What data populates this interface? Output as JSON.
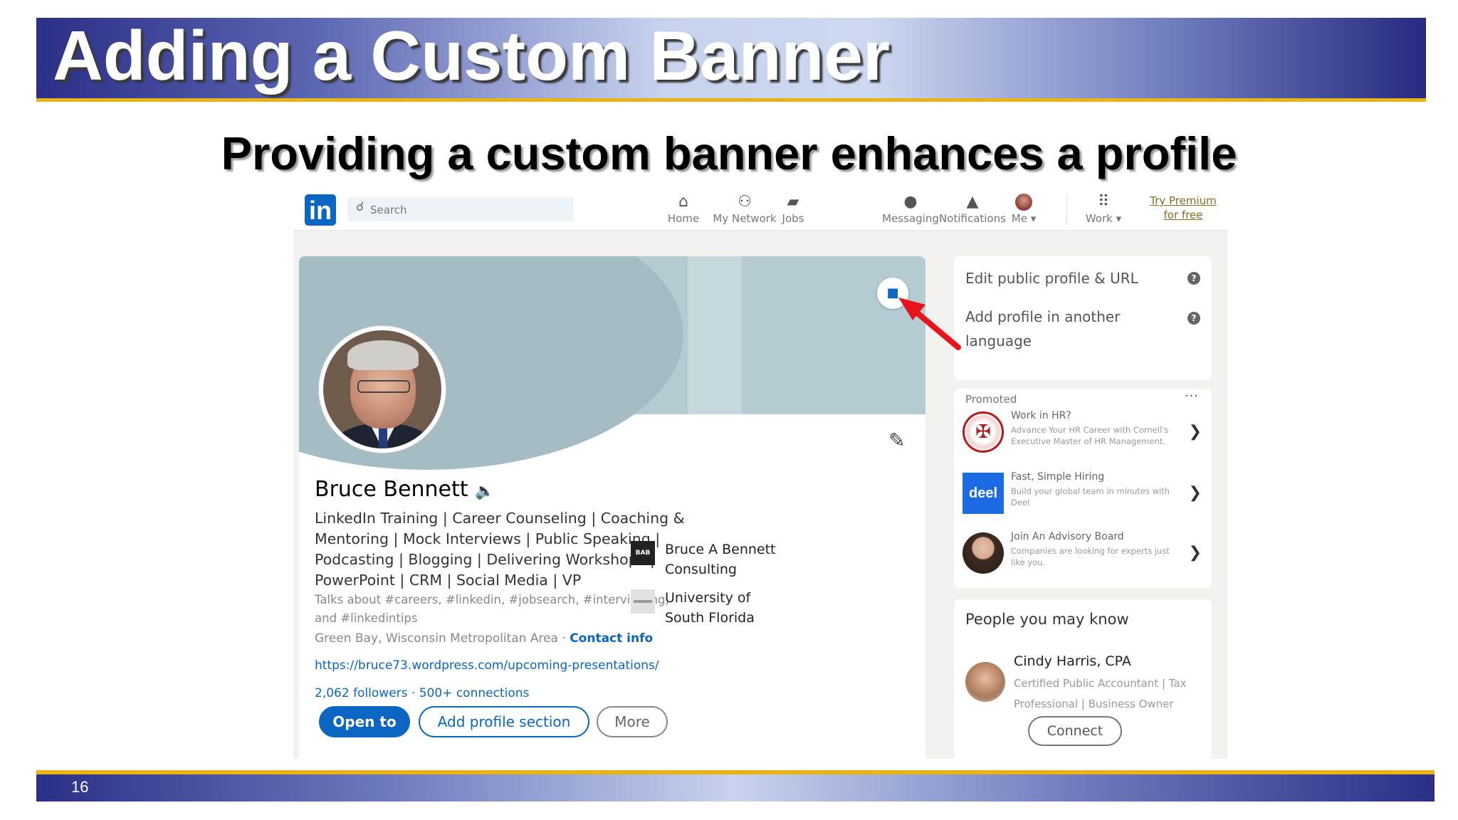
{
  "slide": {
    "title": "Adding a Custom Banner",
    "subtitle": "Providing a custom banner enhances a profile",
    "page_number": "16",
    "colors": {
      "title_bar": "#2b2f86",
      "accent_line": "#e7b413"
    }
  },
  "linkedin": {
    "logo": "in",
    "search": {
      "placeholder": "Search"
    },
    "nav": [
      {
        "icon": "home-icon",
        "label": "Home"
      },
      {
        "icon": "my-network-icon",
        "label": "My Network"
      },
      {
        "icon": "jobs-icon",
        "label": "Jobs"
      },
      {
        "icon": "messaging-icon",
        "label": "Messaging"
      },
      {
        "icon": "notifications-icon",
        "label": "Notifications"
      },
      {
        "icon": "me-avatar-icon",
        "label": "Me ▾"
      },
      {
        "icon": "work-grid-icon",
        "label": "Work ▾"
      }
    ],
    "premium": {
      "line1": "Try Premium",
      "line2": "for free"
    },
    "profile": {
      "name": "Bruce Bennett",
      "headline": "LinkedIn Training | Career Counseling | Coaching & Mentoring | Mock Interviews | Public Speaking | Podcasting | Blogging | Delivering Workshops | PowerPoint | CRM | Social Media | VP",
      "talks_about": "Talks about #careers, #linkedin, #jobsearch, #interviewing, and #linkedintips",
      "location": "Green Bay, Wisconsin Metropolitan Area ·",
      "contact_info": "Contact info",
      "url": "https://bruce73.wordpress.com/upcoming-presentations/",
      "followers": "2,062 followers",
      "connections": "· 500+ connections",
      "buttons": {
        "open_to": "Open to",
        "add_section": "Add profile section",
        "more": "More"
      },
      "experience": [
        {
          "logo": "BAB",
          "name": "Bruce A Bennett Consulting"
        },
        {
          "logo": "",
          "name": "University of South Florida"
        }
      ],
      "brand_color": "#0a66c2",
      "banner_color": "#b3cbd1"
    },
    "sidebar": {
      "links": [
        {
          "label": "Edit public profile & URL"
        },
        {
          "label": "Add profile in another language"
        }
      ],
      "promoted": {
        "label": "Promoted",
        "ads": [
          {
            "title": "Work in HR?",
            "desc": "Advance Your HR Career with Cornell's Executive Master of HR Management."
          },
          {
            "logo_text": "deel",
            "title": "Fast, Simple Hiring",
            "desc": "Build your global team in minutes with Deel"
          },
          {
            "title": "Join An Advisory Board",
            "desc": "Companies are looking for experts just like you."
          }
        ]
      },
      "people": {
        "title": "People you may know",
        "name": "Cindy Harris, CPA",
        "desc": "Certified Public Accountant | Tax Professional | Business Owner",
        "button": "Connect"
      }
    }
  }
}
